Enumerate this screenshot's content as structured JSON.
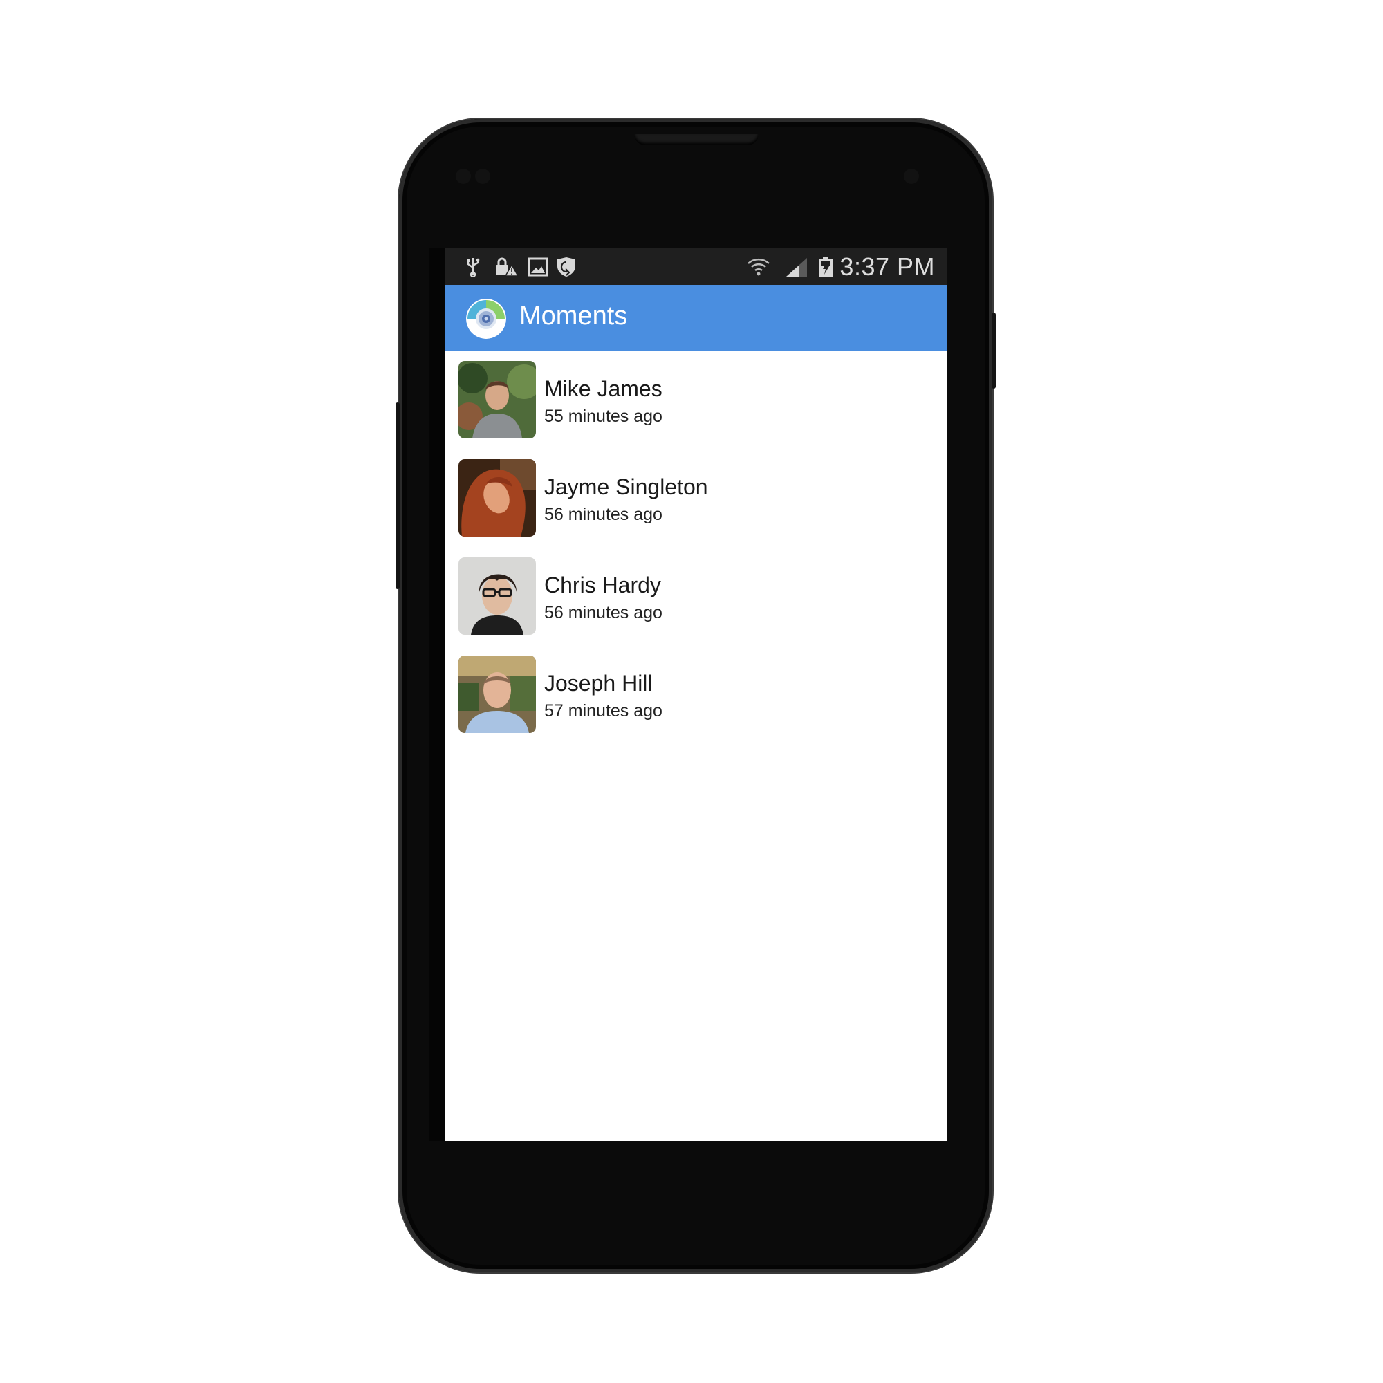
{
  "status_bar": {
    "time": "3:37 PM",
    "left_icons": [
      "usb-icon",
      "lock-warning-icon",
      "image-icon",
      "shield-icon"
    ],
    "right_icons": [
      "wifi-icon",
      "signal-icon",
      "battery-charging-icon"
    ]
  },
  "app_bar": {
    "title": "Moments",
    "icon": "app-logo-icon",
    "color": "#4a8ee0"
  },
  "moments": [
    {
      "name": "Mike James",
      "time": "55 minutes ago"
    },
    {
      "name": "Jayme Singleton",
      "time": "56 minutes ago"
    },
    {
      "name": "Chris Hardy",
      "time": "56 minutes ago"
    },
    {
      "name": "Joseph Hill",
      "time": "57 minutes ago"
    }
  ]
}
